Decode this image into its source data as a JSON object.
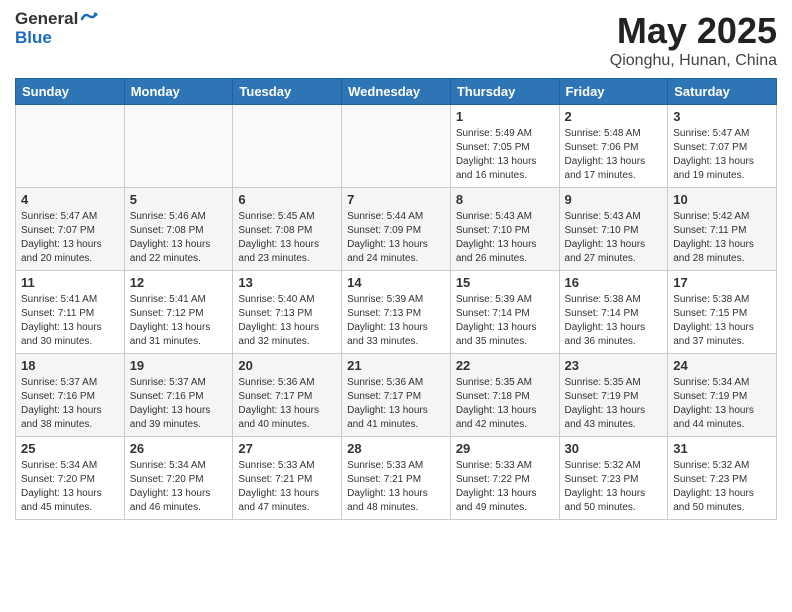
{
  "header": {
    "logo_general": "General",
    "logo_blue": "Blue",
    "title": "May 2025",
    "subtitle": "Qionghu, Hunan, China"
  },
  "days_of_week": [
    "Sunday",
    "Monday",
    "Tuesday",
    "Wednesday",
    "Thursday",
    "Friday",
    "Saturday"
  ],
  "weeks": [
    [
      {
        "day": "",
        "info": ""
      },
      {
        "day": "",
        "info": ""
      },
      {
        "day": "",
        "info": ""
      },
      {
        "day": "",
        "info": ""
      },
      {
        "day": "1",
        "info": "Sunrise: 5:49 AM\nSunset: 7:05 PM\nDaylight: 13 hours\nand 16 minutes."
      },
      {
        "day": "2",
        "info": "Sunrise: 5:48 AM\nSunset: 7:06 PM\nDaylight: 13 hours\nand 17 minutes."
      },
      {
        "day": "3",
        "info": "Sunrise: 5:47 AM\nSunset: 7:07 PM\nDaylight: 13 hours\nand 19 minutes."
      }
    ],
    [
      {
        "day": "4",
        "info": "Sunrise: 5:47 AM\nSunset: 7:07 PM\nDaylight: 13 hours\nand 20 minutes."
      },
      {
        "day": "5",
        "info": "Sunrise: 5:46 AM\nSunset: 7:08 PM\nDaylight: 13 hours\nand 22 minutes."
      },
      {
        "day": "6",
        "info": "Sunrise: 5:45 AM\nSunset: 7:08 PM\nDaylight: 13 hours\nand 23 minutes."
      },
      {
        "day": "7",
        "info": "Sunrise: 5:44 AM\nSunset: 7:09 PM\nDaylight: 13 hours\nand 24 minutes."
      },
      {
        "day": "8",
        "info": "Sunrise: 5:43 AM\nSunset: 7:10 PM\nDaylight: 13 hours\nand 26 minutes."
      },
      {
        "day": "9",
        "info": "Sunrise: 5:43 AM\nSunset: 7:10 PM\nDaylight: 13 hours\nand 27 minutes."
      },
      {
        "day": "10",
        "info": "Sunrise: 5:42 AM\nSunset: 7:11 PM\nDaylight: 13 hours\nand 28 minutes."
      }
    ],
    [
      {
        "day": "11",
        "info": "Sunrise: 5:41 AM\nSunset: 7:11 PM\nDaylight: 13 hours\nand 30 minutes."
      },
      {
        "day": "12",
        "info": "Sunrise: 5:41 AM\nSunset: 7:12 PM\nDaylight: 13 hours\nand 31 minutes."
      },
      {
        "day": "13",
        "info": "Sunrise: 5:40 AM\nSunset: 7:13 PM\nDaylight: 13 hours\nand 32 minutes."
      },
      {
        "day": "14",
        "info": "Sunrise: 5:39 AM\nSunset: 7:13 PM\nDaylight: 13 hours\nand 33 minutes."
      },
      {
        "day": "15",
        "info": "Sunrise: 5:39 AM\nSunset: 7:14 PM\nDaylight: 13 hours\nand 35 minutes."
      },
      {
        "day": "16",
        "info": "Sunrise: 5:38 AM\nSunset: 7:14 PM\nDaylight: 13 hours\nand 36 minutes."
      },
      {
        "day": "17",
        "info": "Sunrise: 5:38 AM\nSunset: 7:15 PM\nDaylight: 13 hours\nand 37 minutes."
      }
    ],
    [
      {
        "day": "18",
        "info": "Sunrise: 5:37 AM\nSunset: 7:16 PM\nDaylight: 13 hours\nand 38 minutes."
      },
      {
        "day": "19",
        "info": "Sunrise: 5:37 AM\nSunset: 7:16 PM\nDaylight: 13 hours\nand 39 minutes."
      },
      {
        "day": "20",
        "info": "Sunrise: 5:36 AM\nSunset: 7:17 PM\nDaylight: 13 hours\nand 40 minutes."
      },
      {
        "day": "21",
        "info": "Sunrise: 5:36 AM\nSunset: 7:17 PM\nDaylight: 13 hours\nand 41 minutes."
      },
      {
        "day": "22",
        "info": "Sunrise: 5:35 AM\nSunset: 7:18 PM\nDaylight: 13 hours\nand 42 minutes."
      },
      {
        "day": "23",
        "info": "Sunrise: 5:35 AM\nSunset: 7:19 PM\nDaylight: 13 hours\nand 43 minutes."
      },
      {
        "day": "24",
        "info": "Sunrise: 5:34 AM\nSunset: 7:19 PM\nDaylight: 13 hours\nand 44 minutes."
      }
    ],
    [
      {
        "day": "25",
        "info": "Sunrise: 5:34 AM\nSunset: 7:20 PM\nDaylight: 13 hours\nand 45 minutes."
      },
      {
        "day": "26",
        "info": "Sunrise: 5:34 AM\nSunset: 7:20 PM\nDaylight: 13 hours\nand 46 minutes."
      },
      {
        "day": "27",
        "info": "Sunrise: 5:33 AM\nSunset: 7:21 PM\nDaylight: 13 hours\nand 47 minutes."
      },
      {
        "day": "28",
        "info": "Sunrise: 5:33 AM\nSunset: 7:21 PM\nDaylight: 13 hours\nand 48 minutes."
      },
      {
        "day": "29",
        "info": "Sunrise: 5:33 AM\nSunset: 7:22 PM\nDaylight: 13 hours\nand 49 minutes."
      },
      {
        "day": "30",
        "info": "Sunrise: 5:32 AM\nSunset: 7:23 PM\nDaylight: 13 hours\nand 50 minutes."
      },
      {
        "day": "31",
        "info": "Sunrise: 5:32 AM\nSunset: 7:23 PM\nDaylight: 13 hours\nand 50 minutes."
      }
    ]
  ]
}
